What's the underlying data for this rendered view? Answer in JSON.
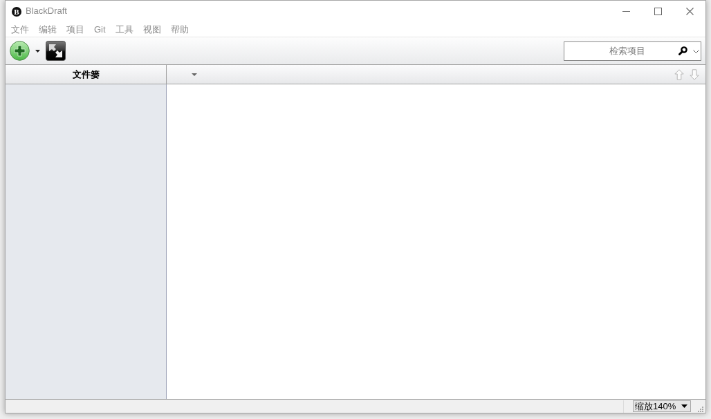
{
  "window": {
    "logo": "B",
    "title": "BlackDraft"
  },
  "menu": [
    {
      "label": "文件"
    },
    {
      "label": "编辑"
    },
    {
      "label": "项目"
    },
    {
      "label": "Git"
    },
    {
      "label": "工具"
    },
    {
      "label": "视图"
    },
    {
      "label": "帮助"
    }
  ],
  "toolbar": {
    "search": {
      "placeholder": "检索项目"
    }
  },
  "sidebar": {
    "title": "文件篓"
  },
  "status_bar": {
    "zoom": "缩放140%"
  }
}
